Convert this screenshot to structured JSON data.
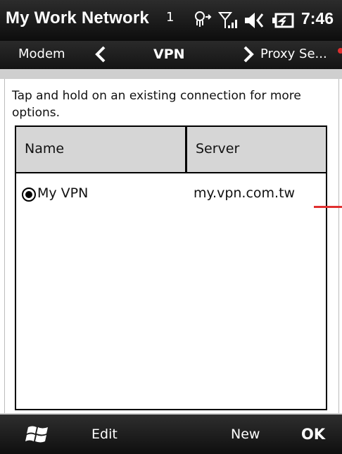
{
  "status_bar": {
    "title": "My Work Network",
    "sim_indicator": "1",
    "time": "7:46",
    "icons": [
      "data-connection-icon",
      "signal-strength-icon",
      "volume-icon",
      "battery-charging-icon"
    ]
  },
  "tabs": {
    "previous": "Modem",
    "current": "VPN",
    "next": "Proxy Se..."
  },
  "content": {
    "instruction": "Tap and hold on an existing connection for more options.",
    "columns": [
      "Name",
      "Server"
    ],
    "rows": [
      {
        "name": "My VPN",
        "server": "my.vpn.com.tw",
        "selected": true
      }
    ]
  },
  "softkeys": {
    "left": "Edit",
    "right": "New",
    "ok": "OK"
  },
  "colors": {
    "bar_background": "#1a1a1a",
    "header_gray": "#d6d6d6",
    "callout_red": "#e03030"
  }
}
